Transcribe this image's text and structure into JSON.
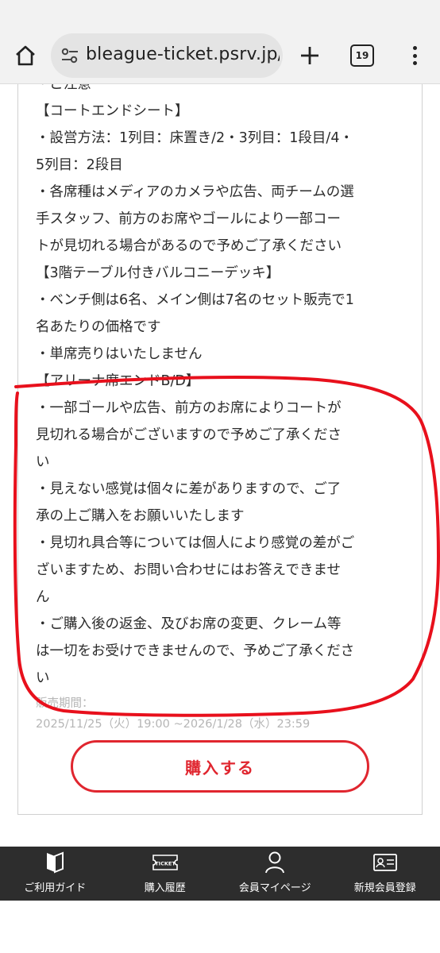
{
  "browser": {
    "url": "bleague-ticket.psrv.jp/sa",
    "tab_count": "19",
    "icons": [
      "home-icon",
      "site-settings-icon",
      "plus-icon",
      "tab-switcher-icon",
      "more-menu-icon"
    ]
  },
  "notes": {
    "partial_heading": "・ご注意",
    "lines": [
      "【コートエンドシート】",
      "・設営方法：1列目：床置き/2・3列目：1段目/4・",
      "5列目：2段目",
      "・各席種はメディアのカメラや広告、両チームの選",
      "手スタッフ、前方のお席やゴールにより一部コー",
      "トが見切れる場合があるので予めご了承ください",
      "【3階テーブル付きバルコニーデッキ】",
      "・ベンチ側は6名、メイン側は7名のセット販売で1",
      "名あたりの価格です",
      "・単席売りはいたしません",
      "【アリーナ席エンドB/D】",
      "・一部ゴールや広告、前方のお席によりコートが",
      "見切れる場合がございますので予めご了承くださ",
      "い",
      "・見えない感覚は個々に差がありますので、ご了",
      "承の上ご購入をお願いいたします",
      "・見切れ具合等については個人により感覚の差がご",
      "ざいますため、お問い合わせにはお答えできませ",
      "ん",
      "・ご購入後の返金、及びお席の変更、クレーム等",
      "は一切をお受けできませんので、予めご了承くださ",
      "い"
    ],
    "sale_period_label": "販売期間：",
    "sale_period_value": "2025/11/25（火）19:00 ~2026/1/28（水）23:59"
  },
  "buy_button": {
    "label": "購入する"
  },
  "colors": {
    "accent": "#e0262f",
    "annotation": "#e8101c",
    "nav_bg": "#2d2d2d"
  },
  "bottom_nav": {
    "items": [
      {
        "label": "ご利用ガイド",
        "icon": "book-icon"
      },
      {
        "label": "購入履歴",
        "icon": "ticket-icon",
        "icon_text": "TICKET"
      },
      {
        "label": "会員マイページ",
        "icon": "person-icon"
      },
      {
        "label": "新規会員登録",
        "icon": "id-card-icon"
      }
    ]
  }
}
